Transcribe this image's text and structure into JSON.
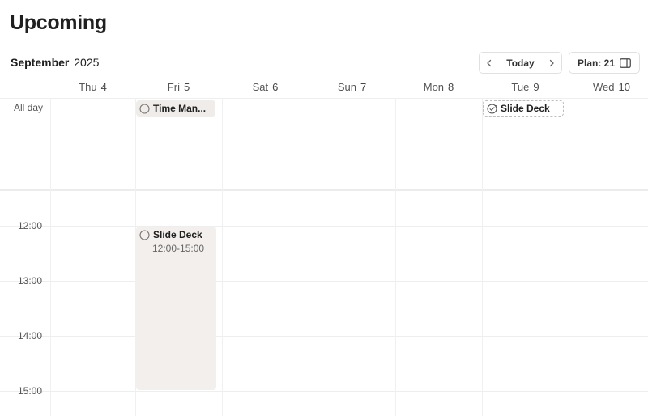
{
  "header": {
    "title": "Upcoming"
  },
  "toolbar": {
    "month": "September",
    "year": "2025",
    "today_label": "Today",
    "plan_label": "Plan: 21"
  },
  "days": [
    {
      "dow": "Thu",
      "num": "4"
    },
    {
      "dow": "Fri",
      "num": "5"
    },
    {
      "dow": "Sat",
      "num": "6"
    },
    {
      "dow": "Sun",
      "num": "7"
    },
    {
      "dow": "Mon",
      "num": "8"
    },
    {
      "dow": "Tue",
      "num": "9"
    },
    {
      "dow": "Wed",
      "num": "10"
    }
  ],
  "grid": {
    "allday_label": "All day",
    "hours": [
      "12:00",
      "13:00",
      "14:00",
      "15:00"
    ]
  },
  "allday_events": {
    "fri": {
      "title": "Time Man..."
    },
    "tue": {
      "title": "Slide Deck"
    }
  },
  "timed_events": {
    "fri": {
      "title": "Slide Deck",
      "time": "12:00-15:00"
    }
  },
  "colors": {
    "event_bg": "#f2efec",
    "chip_bg": "#efecea",
    "grid_line": "#eeeeee"
  },
  "icons": {
    "prev": "chevron-left-icon",
    "next": "chevron-right-icon",
    "panel": "sidebar-panel-icon",
    "task": "circle-checkbox-icon",
    "recurring": "recurring-task-icon"
  }
}
